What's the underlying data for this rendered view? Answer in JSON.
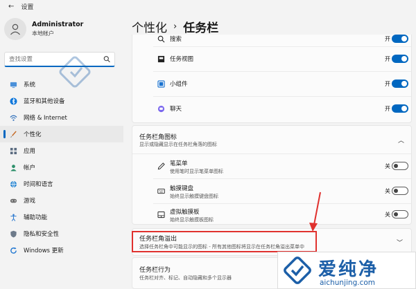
{
  "window": {
    "title": "设置"
  },
  "profile": {
    "name": "Administrator",
    "account": "本地帐户"
  },
  "search": {
    "placeholder": "查找设置"
  },
  "nav": {
    "items": [
      {
        "label": "系统",
        "icon": "monitor-icon"
      },
      {
        "label": "蓝牙和其他设备",
        "icon": "bluetooth-icon"
      },
      {
        "label": "网络 & Internet",
        "icon": "wifi-icon"
      },
      {
        "label": "个性化",
        "icon": "brush-icon",
        "active": true
      },
      {
        "label": "应用",
        "icon": "apps-icon"
      },
      {
        "label": "帐户",
        "icon": "person-icon"
      },
      {
        "label": "时间和语言",
        "icon": "globe-icon"
      },
      {
        "label": "游戏",
        "icon": "gamepad-icon"
      },
      {
        "label": "辅助功能",
        "icon": "accessibility-icon"
      },
      {
        "label": "隐私和安全性",
        "icon": "shield-icon"
      },
      {
        "label": "Windows 更新",
        "icon": "update-icon"
      }
    ]
  },
  "breadcrumb": {
    "parent": "个性化",
    "separator": "›",
    "current": "任务栏"
  },
  "taskbar_items": {
    "rows": [
      {
        "label": "搜索",
        "state": "开",
        "on": true,
        "icon": "search-icon"
      },
      {
        "label": "任务视图",
        "state": "开",
        "on": true,
        "icon": "task-view-icon"
      },
      {
        "label": "小组件",
        "state": "开",
        "on": true,
        "icon": "widgets-icon"
      },
      {
        "label": "聊天",
        "state": "开",
        "on": true,
        "icon": "chat-icon"
      }
    ]
  },
  "corner_icons": {
    "title": "任务栏角图标",
    "subtitle": "显示或隐藏显示在任务栏角落的图标",
    "rows": [
      {
        "label": "笔菜单",
        "desc": "使用笔时显示笔菜单图标",
        "state": "关",
        "on": false,
        "icon": "pen-icon"
      },
      {
        "label": "触摸键盘",
        "desc": "始终显示触摸键盘图标",
        "state": "关",
        "on": false,
        "icon": "keyboard-icon"
      },
      {
        "label": "虚拟触摸板",
        "desc": "始终显示触摸板图标",
        "state": "关",
        "on": false,
        "icon": "touchpad-icon"
      }
    ]
  },
  "overflow": {
    "title": "任务栏角溢出",
    "subtitle": "选择任务栏角中可能显示的图标 - 所有其他图标将显示在任务栏角溢出菜单中"
  },
  "behavior": {
    "title": "任务栏行为",
    "subtitle": "任务栏对齐、标记、自动隐藏和多个显示器"
  },
  "watermark": {
    "title": "爱纯净",
    "url": "aichunjing.com"
  },
  "colors": {
    "accent": "#0067c0",
    "highlight": "#e0312e",
    "watermark": "#1c5fa8"
  }
}
